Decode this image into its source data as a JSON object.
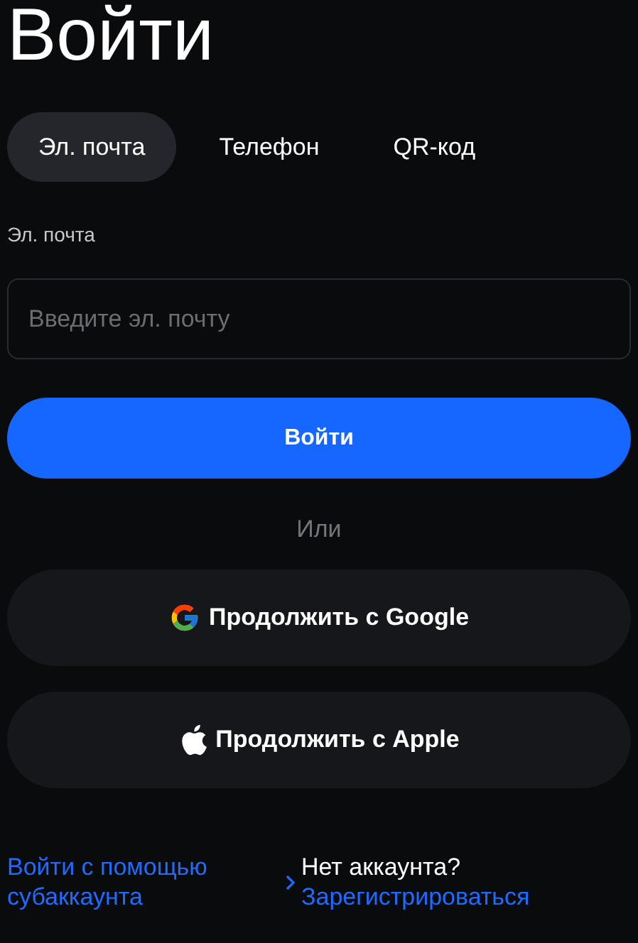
{
  "title": "Войти",
  "tabs": [
    {
      "label": "Эл. почта",
      "selected": true
    },
    {
      "label": "Телефон",
      "selected": false
    },
    {
      "label": "QR-код",
      "selected": false
    }
  ],
  "email_field": {
    "label": "Эл. почта",
    "placeholder": "Введите эл. почту"
  },
  "submit_button": "Войти",
  "divider_text": "Или",
  "social_buttons": [
    {
      "kind": "google",
      "label": "Продолжить с Google"
    },
    {
      "kind": "apple",
      "label": "Продолжить с Apple"
    }
  ],
  "footer": {
    "subaccount_link": "Войти с помощью субаккаунта",
    "signup_prompt": "Нет аккаунта?",
    "signup_link": "Зарегистрироваться"
  }
}
